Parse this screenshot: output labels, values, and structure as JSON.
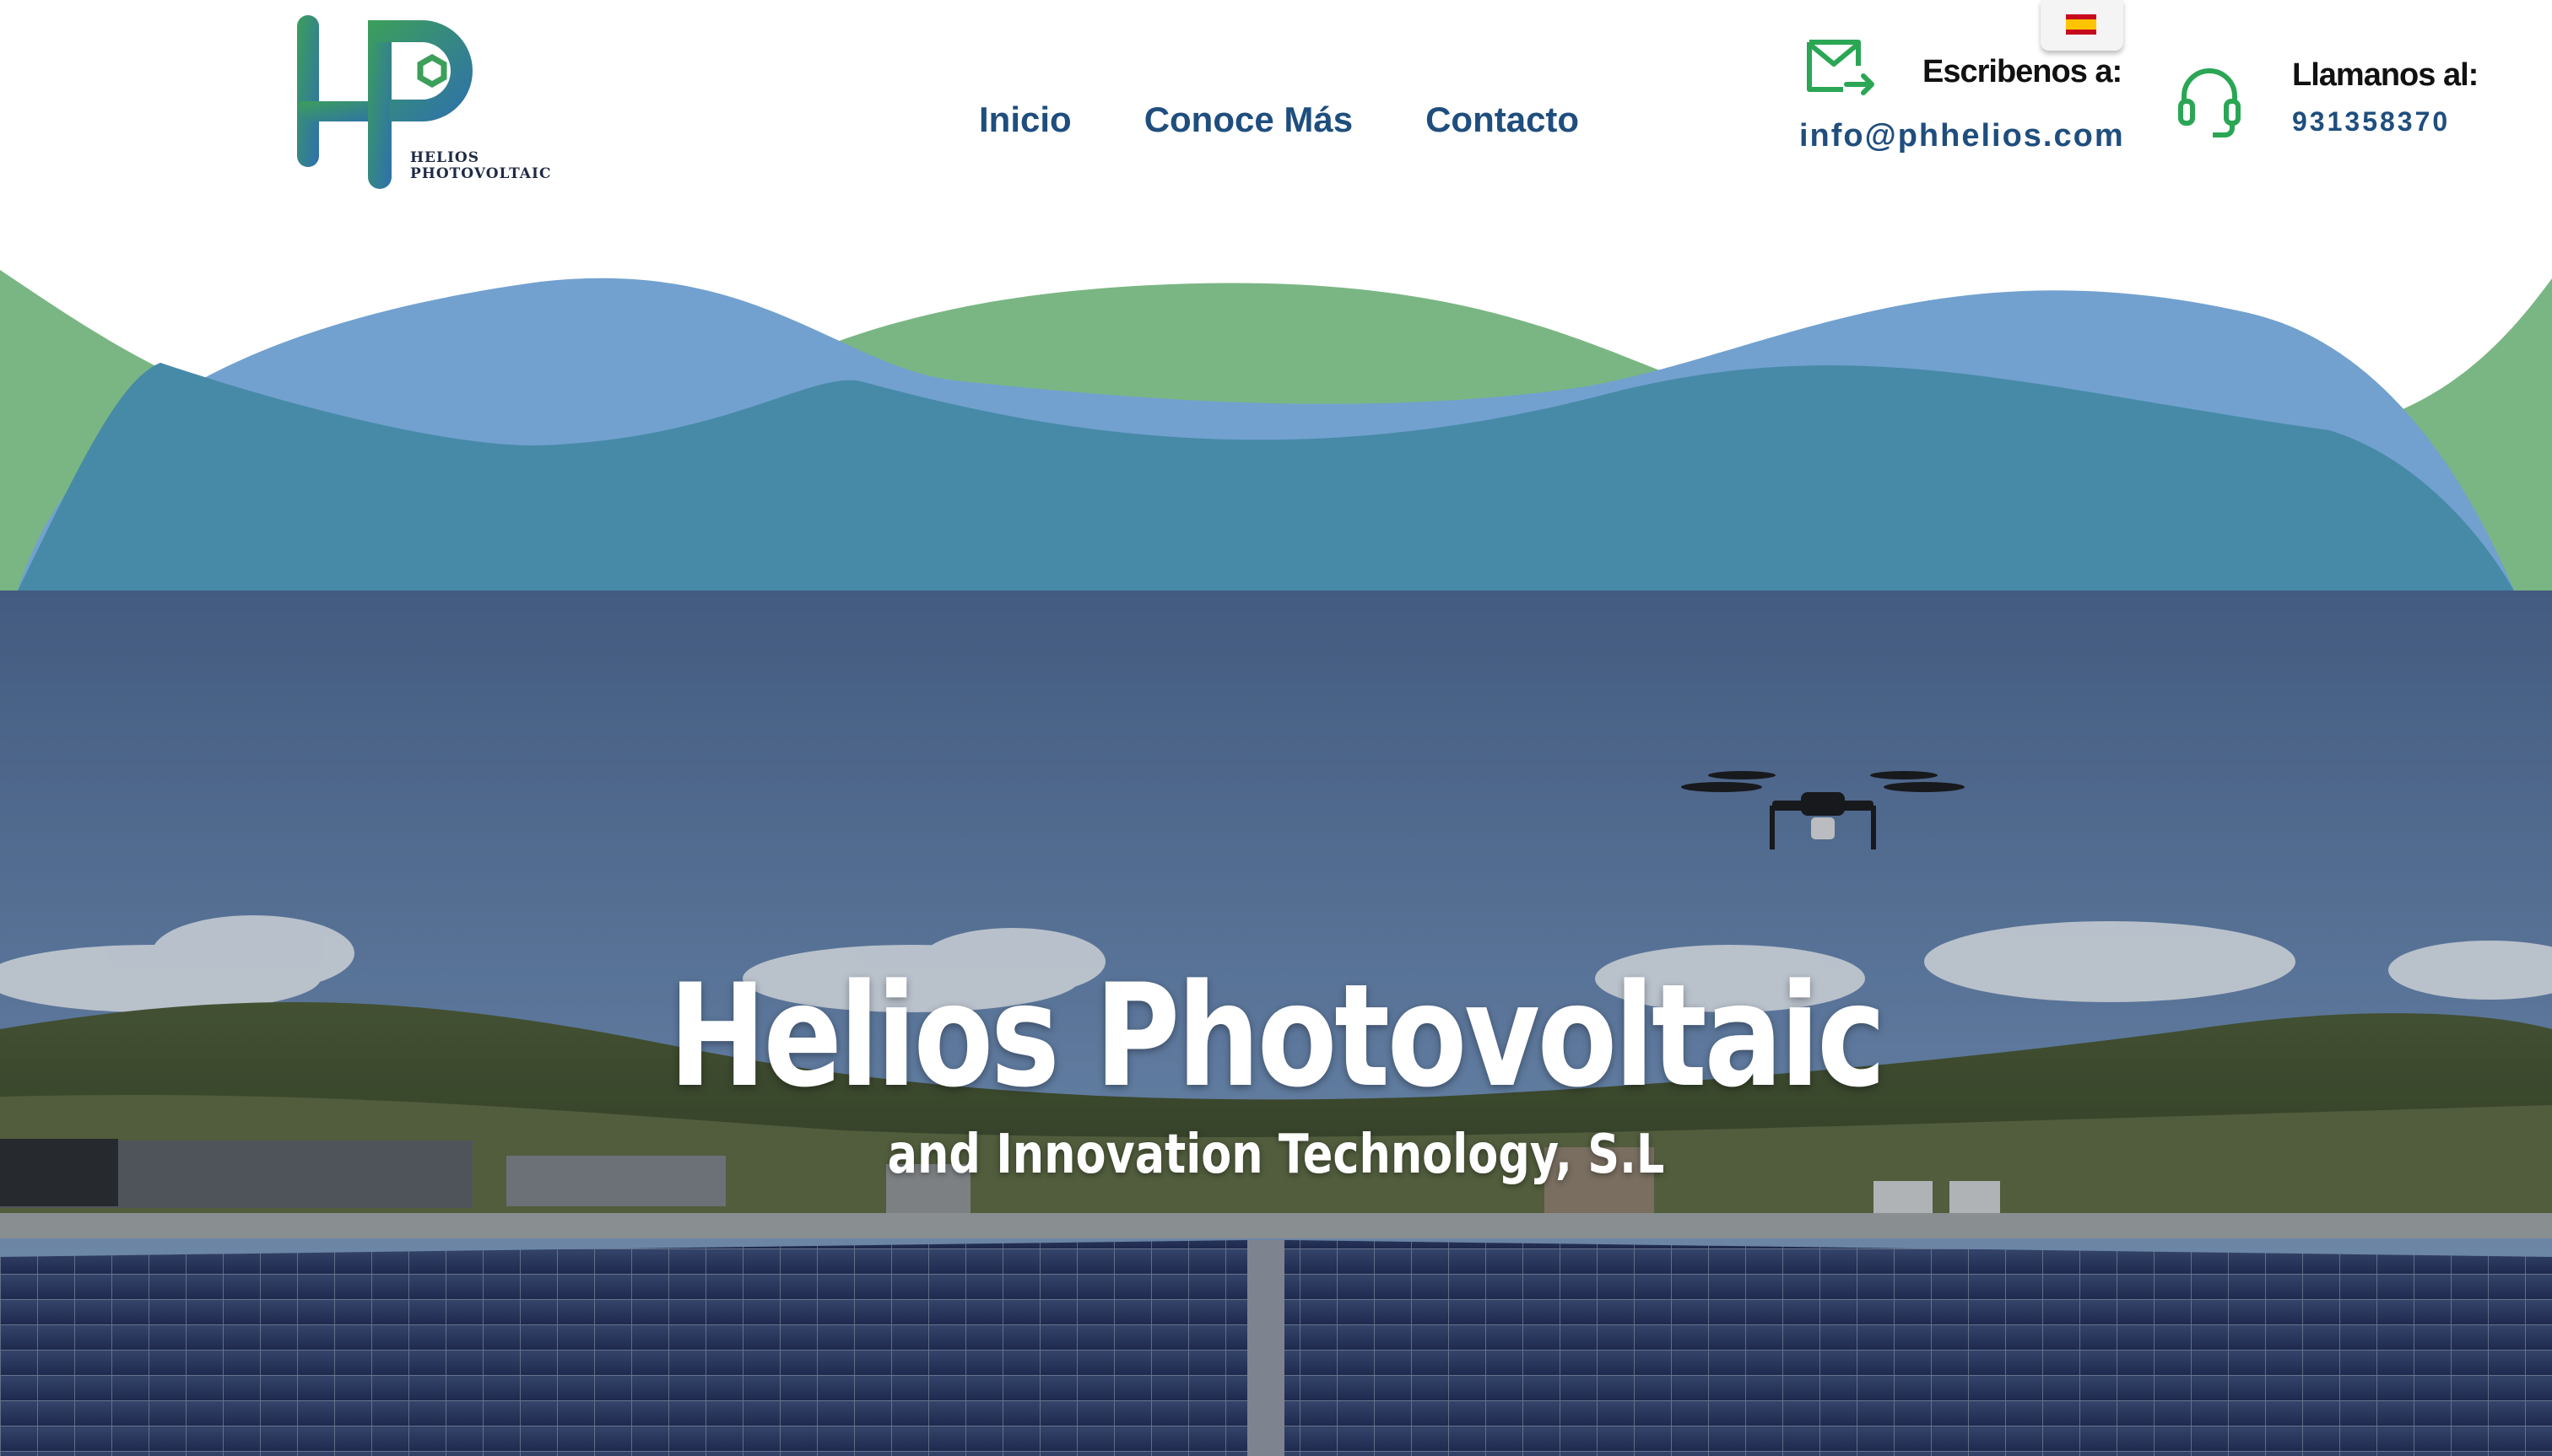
{
  "brand": {
    "logo_line1": "HELIOS",
    "logo_line2": "PHOTOVOLTAIC",
    "logo_icon": "hp-monogram-logo",
    "colors": {
      "blue": "#2e6fae",
      "green": "#3c9f5a",
      "navy": "#1f4e7e"
    }
  },
  "nav": {
    "items": [
      {
        "label": "Inicio"
      },
      {
        "label": "Conoce Más"
      },
      {
        "label": "Contacto"
      }
    ]
  },
  "language": {
    "selected": "es",
    "icon": "spain-flag-icon"
  },
  "contact": {
    "email_label": "Escribenos a:",
    "email": "info@phhelios.com",
    "email_icon": "mail-send-icon",
    "phone_label": "Llamanos al:",
    "phone": "931358370",
    "phone_icon": "headset-icon"
  },
  "hero": {
    "title": "Helios Photovoltaic",
    "subtitle": "and Innovation Technology, S.L"
  }
}
